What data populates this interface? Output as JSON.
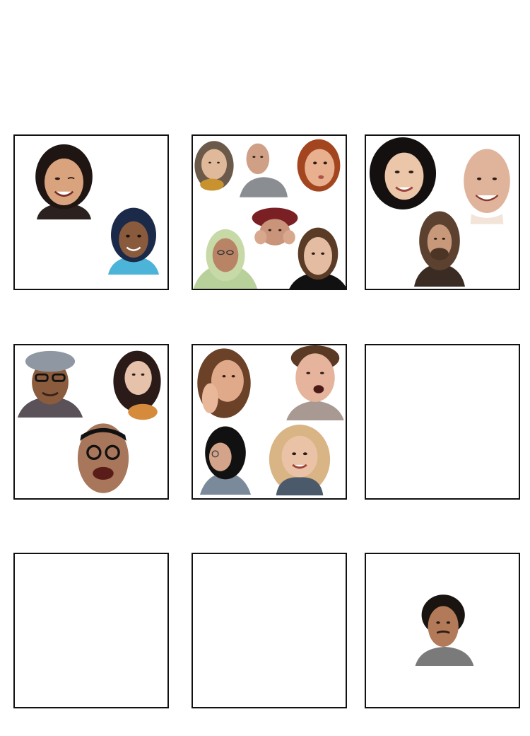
{
  "colors": {
    "border": "#111111",
    "background": "#ffffff"
  },
  "boxes": [
    {
      "id": "1",
      "face_count": 2
    },
    {
      "id": "2",
      "face_count": 6
    },
    {
      "id": "3",
      "face_count": 3
    },
    {
      "id": "4",
      "face_count": 3
    },
    {
      "id": "5",
      "face_count": 4
    },
    {
      "id": "6",
      "face_count": 0
    },
    {
      "id": "7",
      "face_count": 0
    },
    {
      "id": "8",
      "face_count": 0
    },
    {
      "id": "9",
      "face_count": 1
    }
  ]
}
